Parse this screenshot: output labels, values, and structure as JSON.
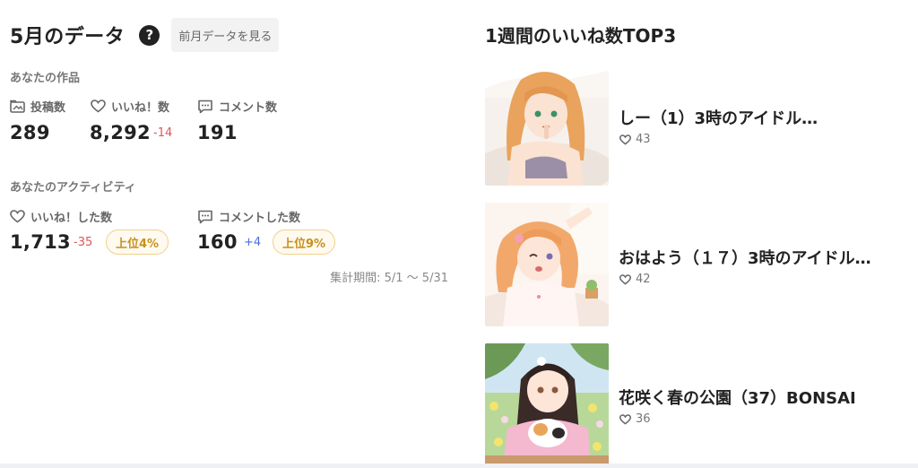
{
  "monthly": {
    "title": "5月のデータ",
    "help_icon": "?",
    "prev_button": "前月データを見る",
    "works_section": "あなたの作品",
    "posts": {
      "label": "投稿数",
      "value": "289"
    },
    "likes": {
      "label": "いいね！数",
      "value": "8,292",
      "delta": "-14"
    },
    "comments": {
      "label": "コメント数",
      "value": "191"
    },
    "activity_section": "あなたのアクティビティ",
    "liked": {
      "label": "いいね！した数",
      "value": "1,713",
      "delta": "-35",
      "rank": "上位4%"
    },
    "commented": {
      "label": "コメントした数",
      "value": "160",
      "delta": "+4",
      "rank": "上位9%"
    },
    "period": "集計期間: 5/1 〜 5/31"
  },
  "weekly_top": {
    "title": "1週間のいいね数TOP3",
    "items": [
      {
        "title": "しー（1）3時のアイドル…",
        "likes": "43"
      },
      {
        "title": "おはよう（１７）3時のアイドル…",
        "likes": "42"
      },
      {
        "title": "花咲く春の公園（37）BONSAI",
        "likes": "36"
      }
    ]
  },
  "colors": {
    "negative": "#e05555",
    "positive": "#4a6fdc",
    "badge": "#c8901a"
  }
}
